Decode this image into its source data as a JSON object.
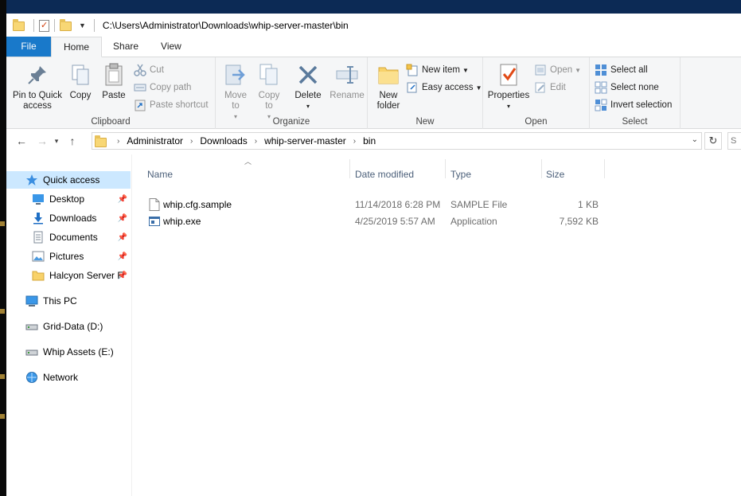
{
  "title_bar": {
    "path": "C:\\Users\\Administrator\\Downloads\\whip-server-master\\bin"
  },
  "tabs": [
    {
      "label": "File"
    },
    {
      "label": "Home"
    },
    {
      "label": "Share"
    },
    {
      "label": "View"
    }
  ],
  "ribbon": {
    "clipboard": {
      "label": "Clipboard",
      "pin_quick_access": "Pin to Quick access",
      "copy": "Copy",
      "paste": "Paste",
      "cut": "Cut",
      "copy_path": "Copy path",
      "paste_shortcut": "Paste shortcut"
    },
    "organize": {
      "label": "Organize",
      "move_to": "Move to",
      "copy_to": "Copy to",
      "delete": "Delete",
      "rename": "Rename"
    },
    "new": {
      "label": "New",
      "new_folder": "New folder",
      "new_item": "New item",
      "easy_access": "Easy access"
    },
    "open": {
      "label": "Open",
      "properties": "Properties",
      "open": "Open",
      "edit": "Edit"
    },
    "select": {
      "label": "Select",
      "select_all": "Select all",
      "select_none": "Select none",
      "invert_selection": "Invert selection"
    }
  },
  "address": {
    "crumbs": [
      "Administrator",
      "Downloads",
      "whip-server-master",
      "bin"
    ],
    "search_placeholder": "S"
  },
  "nav_pane": {
    "quick_access": "Quick access",
    "desktop": "Desktop",
    "downloads": "Downloads",
    "documents": "Documents",
    "pictures": "Pictures",
    "halcyon": "Halcyon Server F",
    "this_pc": "This PC",
    "grid_data": "Grid-Data (D:)",
    "whip_assets": "Whip Assets (E:)",
    "network": "Network"
  },
  "columns": {
    "name": "Name",
    "date": "Date modified",
    "type": "Type",
    "size": "Size"
  },
  "files": [
    {
      "name": "whip.cfg.sample",
      "date": "11/14/2018 6:28 PM",
      "type": "SAMPLE File",
      "size": "1 KB",
      "icon": "file-icon"
    },
    {
      "name": "whip.exe",
      "date": "4/25/2019 5:57 AM",
      "type": "Application",
      "size": "7,592 KB",
      "icon": "application-icon"
    }
  ]
}
